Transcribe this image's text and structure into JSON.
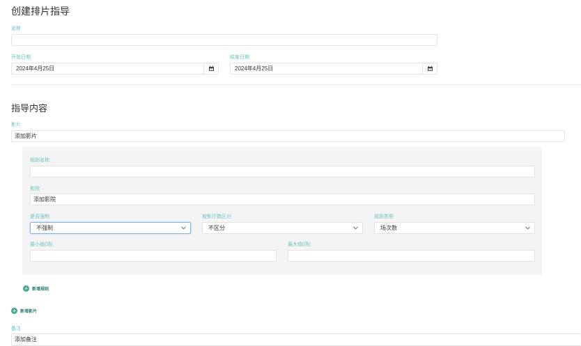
{
  "page_title": "创建排片指导",
  "form": {
    "name_label": "名称",
    "name_value": "",
    "start_label": "开始日期",
    "start_value": "2024年4月25日",
    "end_label": "结束日期",
    "end_value": "2024年4月25日"
  },
  "section_title": "指导内容",
  "films": {
    "label": "影片",
    "value": "添加影片"
  },
  "rule": {
    "name_label": "规则名称",
    "name_value": "",
    "cinema_label": "影院",
    "cinema_value": "添加影院",
    "force_label": "是否强制",
    "force_value": "不强制",
    "split_label": "按影厅数区分",
    "split_value": "不区分",
    "type_label": "规则类型",
    "type_value": "场次数",
    "min_label": "最小值(场)",
    "min_value": "",
    "max_label": "最大值(场)",
    "max_value": ""
  },
  "add_rule_label": "新增规则",
  "add_film_label": "新增影片",
  "remark": {
    "label": "备注",
    "value": "添加备注"
  },
  "colors": {
    "label_teal": "#6dc2bd",
    "add_icon_green": "#3daa8e",
    "panel_bg": "#f4f4f4",
    "focus_border": "#7fb7e8"
  },
  "icons": {
    "calendar": "calendar-icon",
    "dropdown": "chevron-down-icon",
    "add": "plus-circle-icon"
  }
}
